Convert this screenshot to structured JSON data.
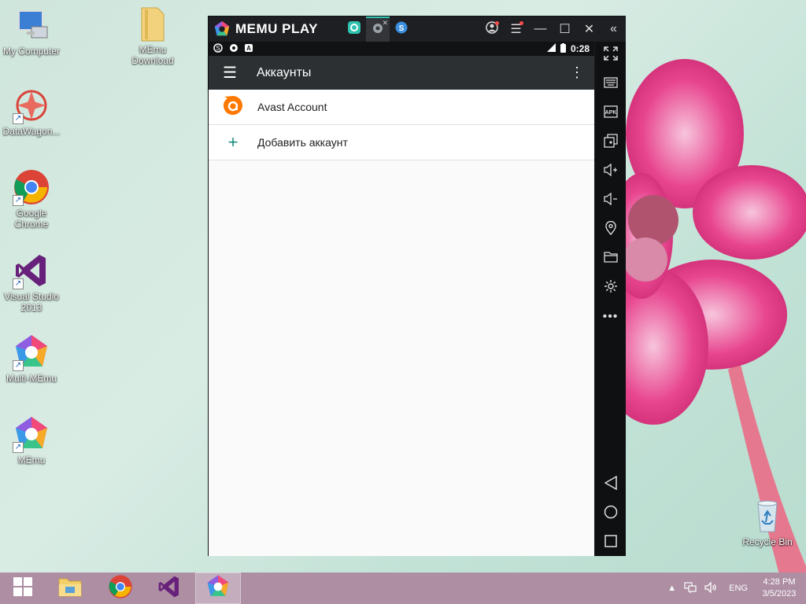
{
  "desktop": {
    "icons": [
      {
        "label": "My Computer",
        "icon": "computer-icon"
      },
      {
        "label": "MEmu Download",
        "icon": "folder-icon"
      },
      {
        "label": "DataWagon...",
        "icon": "datawagon-icon"
      },
      {
        "label": "Google Chrome",
        "icon": "chrome-icon"
      },
      {
        "label": "Visual Studio 2013",
        "icon": "visual-studio-icon"
      },
      {
        "label": "Multi-MEmu",
        "icon": "multi-memu-icon"
      },
      {
        "label": "MEmu",
        "icon": "memu-icon"
      },
      {
        "label": "Recycle Bin",
        "icon": "recycle-bin-icon"
      }
    ]
  },
  "memu": {
    "logo_text": "MEMU PLAY",
    "accent": "#2fc2b0",
    "tabs": [
      {
        "icon": "app-tab-icon"
      },
      {
        "icon": "settings-tab-icon",
        "active": true
      },
      {
        "icon": "browser-tab-icon"
      }
    ],
    "status_bar": {
      "time": "0:28"
    },
    "app_bar": {
      "title": "Аккаунты"
    },
    "accounts": [
      {
        "label": "Avast Account",
        "icon": "avast-icon",
        "color": "#ff7800"
      },
      {
        "label": "Добавить аккаунт",
        "icon": "plus-icon",
        "color": "#1f8b7c"
      }
    ],
    "sidebar_buttons": [
      "fullscreen-icon",
      "keyboard-icon",
      "apk-icon",
      "multi-window-icon",
      "volume-up-icon",
      "volume-down-icon",
      "location-icon",
      "folder-icon",
      "settings-icon",
      "more-icon",
      "back-icon",
      "home-icon",
      "recents-icon"
    ]
  },
  "taskbar": {
    "background": "#ad8ea3",
    "language": "ENG",
    "time": "4:28 PM",
    "date": "3/5/2023"
  }
}
